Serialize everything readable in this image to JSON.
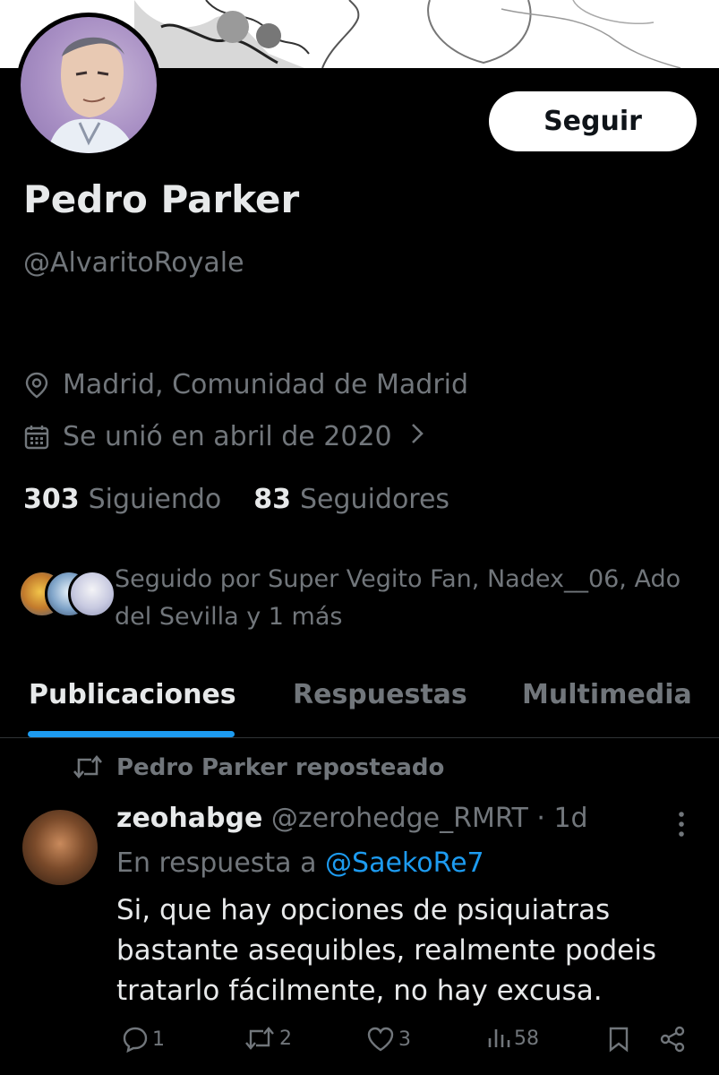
{
  "profile": {
    "follow_label": "Seguir",
    "display_name": "Pedro Parker",
    "handle": "@AlvaritoRoyale",
    "location": "Madrid, Comunidad de Madrid",
    "joined": "Se unió en abril de 2020",
    "following_count": "303",
    "following_label": "Siguiendo",
    "followers_count": "83",
    "followers_label": "Seguidores",
    "followed_by_text": "Seguido por Super Vegito Fan, Nadex__06, Ado del Sevilla y 1 más"
  },
  "tabs": [
    {
      "label": "Publicaciones",
      "active": true
    },
    {
      "label": "Respuestas",
      "active": false
    },
    {
      "label": "Multimedia",
      "active": false
    }
  ],
  "post": {
    "repost_label": "Pedro Parker reposteado",
    "author_name": "zeohabge",
    "author_meta": "@zerohedge_RMRT · 1d",
    "reply_prefix": "En respuesta a",
    "reply_mention": "@SaekoRe7",
    "text": "Si, que hay opciones de psiquiatras bastante asequibles, realmente podeis tratarlo fácilmente, no hay excusa.",
    "actions": {
      "replies": "1",
      "reposts": "2",
      "likes": "3",
      "views": "58"
    }
  },
  "colors": {
    "background": "#000000",
    "text_primary": "#e7e9ea",
    "text_secondary": "#71767b",
    "accent": "#1d9bf0"
  },
  "icons": [
    "location-pin-icon",
    "calendar-icon",
    "chevron-right-icon",
    "repost-icon",
    "reply-icon",
    "like-icon",
    "views-icon",
    "bookmark-icon",
    "share-icon",
    "more-options-icon"
  ]
}
